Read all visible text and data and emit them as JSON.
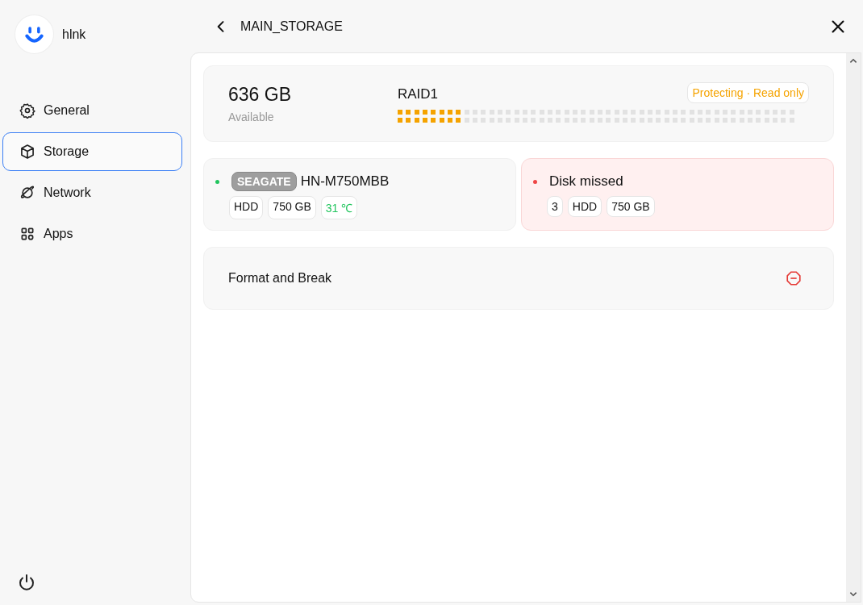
{
  "user": {
    "name": "hlnk"
  },
  "nav": [
    {
      "label": "General",
      "selected": false
    },
    {
      "label": "Storage",
      "selected": true
    },
    {
      "label": "Network",
      "selected": false
    },
    {
      "label": "Apps",
      "selected": false
    }
  ],
  "header": {
    "title": "MAIN_STORAGE"
  },
  "summary": {
    "capacity": "636 GB",
    "capacity_label": "Available",
    "raid": "RAID1",
    "status": "Protecting · Read only",
    "level": 0.166
  },
  "disks": [
    {
      "kind": "disk",
      "color": "#22c55e",
      "brand": "SEAGATE",
      "name": "HN-M750MBB",
      "tags": [
        {
          "text": "HDD",
          "kind": "plain"
        },
        {
          "text": "750 GB",
          "kind": "plain"
        },
        {
          "text": "31 ℃",
          "kind": "temp"
        }
      ]
    },
    {
      "kind": "missing",
      "color": "#ef4444",
      "name": "Disk missed",
      "tags": [
        {
          "text": "3",
          "kind": "plain"
        },
        {
          "text": "HDD",
          "kind": "plain"
        },
        {
          "text": "750 GB",
          "kind": "plain"
        }
      ]
    }
  ],
  "action": {
    "label": "Format and Break"
  }
}
